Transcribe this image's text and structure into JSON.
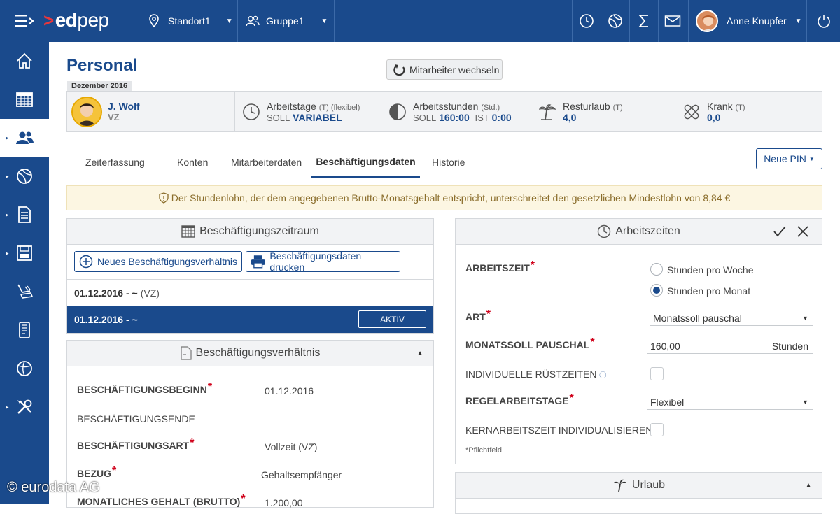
{
  "topbar": {
    "logo_prefix": "ed",
    "logo_suffix": "pep",
    "location": "Standort1",
    "group": "Gruppe1",
    "user_name": "Anne Knupfer"
  },
  "page": {
    "title": "Personal",
    "switch_button": "Mitarbeiter wechseln",
    "month": "Dezember 2016"
  },
  "employee": {
    "name": "J. Wolf",
    "type": "VZ"
  },
  "infobar": {
    "workdays": {
      "label": "Arbeitstage",
      "sub": "(T) (flexibel)",
      "soll_label": "SOLL",
      "soll_value": "VARIABEL"
    },
    "workhours": {
      "label": "Arbeitsstunden",
      "sub": "(Std.)",
      "soll_label": "SOLL",
      "soll_value": "160:00",
      "ist_label": "IST",
      "ist_value": "0:00"
    },
    "vacation": {
      "label": "Resturlaub",
      "sub": "(T)",
      "value": "4,0"
    },
    "sick": {
      "label": "Krank",
      "sub": "(T)",
      "value": "0,0"
    }
  },
  "tabs": [
    "Zeiterfassung",
    "Konten",
    "Mitarbeiterdaten",
    "Beschäftigungsdaten",
    "Historie"
  ],
  "pin_button": "Neue PIN",
  "warning": "Der Stundenlohn, der dem angegebenen Brutto-Monatsgehalt entspricht, unterschreitet den gesetzlichen Mindestlohn von 8,84 €",
  "period_panel": {
    "title": "Beschäftigungszeitraum",
    "new_button": "Neues Beschäftigungsverhältnis",
    "print_button": "Beschäftigungsdaten drucken",
    "rows": [
      {
        "range": "01.12.2016 - ~",
        "suffix": "(VZ)"
      },
      {
        "range": "01.12.2016 - ~",
        "badge": "AKTIV"
      }
    ]
  },
  "employment_panel": {
    "title": "Beschäftigungsverhältnis",
    "fields": [
      {
        "label": "BESCHÄFTIGUNGSBEGINN",
        "value": "01.12.2016"
      },
      {
        "label": "BESCHÄFTIGUNGSENDE",
        "value": ""
      },
      {
        "label": "BESCHÄFTIGUNGSART",
        "value": "Vollzeit (VZ)"
      },
      {
        "label": "BEZUG",
        "value": "Gehaltsempfänger"
      },
      {
        "label": "MONATLICHES GEHALT (BRUTTO)",
        "value": "1.200,00"
      }
    ]
  },
  "worktime_panel": {
    "title": "Arbeitszeiten",
    "arbeitszeit_label": "ARBEITSZEIT",
    "option_week": "Stunden pro Woche",
    "option_month": "Stunden pro Monat",
    "art_label": "ART",
    "art_value": "Monatssoll pauschal",
    "monatssoll_label": "MONATSSOLL PAUSCHAL",
    "monatssoll_value": "160,00",
    "monatssoll_unit": "Stunden",
    "ruest_label": "INDIVIDUELLE RÜSTZEITEN",
    "regel_label": "REGELARBEITSTAGE",
    "regel_value": "Flexibel",
    "kern_label": "KERNARBEITSZEIT INDIVIDUALISIEREN",
    "required_note": "*Pflichtfeld"
  },
  "vacation_panel": {
    "title": "Urlaub"
  },
  "copyright": "© eurodata AG"
}
